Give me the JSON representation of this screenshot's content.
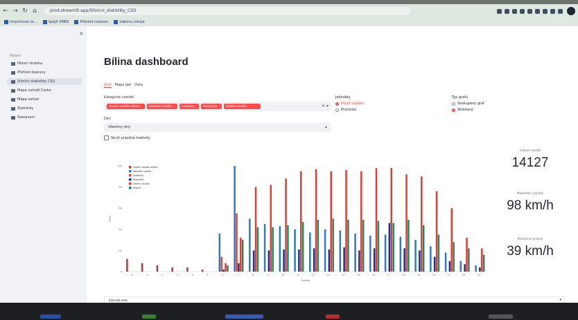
{
  "browser": {
    "url": "prod.streamlit.app/Silnicni_statistiky_CSD",
    "bookmarks": [
      "Importovat ze...",
      "Spájit KMEK",
      "Přehled mateaiv",
      "šablonu zdroje"
    ]
  },
  "sidebar": {
    "heading": "Hlavní",
    "items": [
      {
        "label": "Hlavní stránka",
        "active": false
      },
      {
        "label": "Přehled dopravy",
        "active": false
      },
      {
        "label": "Silniční statistiky CSD",
        "active": true
      },
      {
        "label": "Mapa nehodí Česko",
        "active": false
      },
      {
        "label": "Mapa nehod",
        "active": false
      },
      {
        "label": "Statistiky",
        "active": false
      },
      {
        "label": "Nastavení",
        "active": false
      }
    ]
  },
  "main": {
    "title": "Bílina dashboard",
    "tabs": [
      {
        "label": "Graf",
        "active": true
      },
      {
        "label": "Mapa dat",
        "active": false
      },
      {
        "label": "Data",
        "active": false
      }
    ],
    "multiselect_label": "Kategorie vozidel",
    "chips": [
      "Osobní vozidla celkem",
      "Nákladní vozidla",
      "Autobusy",
      "Motocykly",
      "Ostatní vozidla"
    ],
    "select_label": "Den",
    "select_value": "Všechny dny",
    "checkbox_label": "Skrýt prázdné hodnoty",
    "radio1_label": "Jednotky",
    "radio1_options": [
      "Počet vozidel",
      "Procenta"
    ],
    "radio2_label": "Typ grafu",
    "radio2_options": [
      "Seskupený graf",
      "Skládaný"
    ],
    "expander_label": "Zobrazit data"
  },
  "metrics": [
    {
      "label": "Celkem vozidel",
      "value": "14127"
    },
    {
      "label": "Maximální rychlost",
      "value": "98 km/h"
    },
    {
      "label": "Průměrná rychlost",
      "value": "39 km/h"
    }
  ],
  "chart_data": {
    "type": "bar",
    "categories": [
      "0",
      "1",
      "2",
      "3",
      "4",
      "5",
      "6",
      "7",
      "8",
      "9",
      "10",
      "11",
      "12",
      "13",
      "14",
      "15",
      "16",
      "17",
      "18",
      "19",
      "20",
      "21",
      "22",
      "23"
    ],
    "series": [
      {
        "name": "Osobní vozidla celkem",
        "color": "#a93d3b",
        "values": [
          12,
          8,
          6,
          4,
          4,
          2,
          0,
          0,
          0,
          0,
          0,
          0,
          0,
          0,
          0,
          0,
          0,
          0,
          0,
          0,
          0,
          0,
          0,
          0
        ]
      },
      {
        "name": "Nákladní vozidla",
        "color": "#2f78c4",
        "values": [
          0,
          0,
          0,
          0,
          0,
          0,
          36,
          100,
          50,
          45,
          43,
          40,
          37,
          40,
          39,
          36,
          34,
          35,
          33,
          30,
          24,
          18,
          10,
          6
        ]
      },
      {
        "name": "Autobusy",
        "color": "#c94a45",
        "values": [
          0,
          0,
          0,
          0,
          0,
          0,
          14,
          55,
          0,
          0,
          0,
          0,
          0,
          0,
          0,
          0,
          0,
          0,
          0,
          0,
          0,
          0,
          0,
          0
        ]
      },
      {
        "name": "Motocykly",
        "color": "#1c2f8c",
        "values": [
          0,
          0,
          0,
          0,
          0,
          0,
          2,
          8,
          20,
          20,
          21,
          21,
          22,
          21,
          23,
          20,
          22,
          46,
          22,
          20,
          14,
          10,
          7,
          4
        ]
      },
      {
        "name": "Ostatní vozidla",
        "color": "#e53a35",
        "values": [
          0,
          0,
          0,
          0,
          0,
          0,
          8,
          32,
          80,
          82,
          88,
          95,
          97,
          95,
          96,
          95,
          98,
          98,
          92,
          90,
          76,
          60,
          32,
          22
        ]
      },
      {
        "name": "Zelené",
        "color": "#1f8a5a",
        "values": [
          0,
          0,
          0,
          0,
          0,
          0,
          6,
          30,
          42,
          42,
          44,
          47,
          49,
          50,
          49,
          49,
          48,
          46,
          49,
          44,
          35,
          28,
          22,
          16
        ]
      }
    ],
    "ylim": [
      0,
      100
    ],
    "yticks": [
      "0",
      "20",
      "40",
      "60",
      "80",
      "100"
    ],
    "legend": "top-left",
    "xlabel": "Hodina",
    "ylabel": "Počet"
  }
}
